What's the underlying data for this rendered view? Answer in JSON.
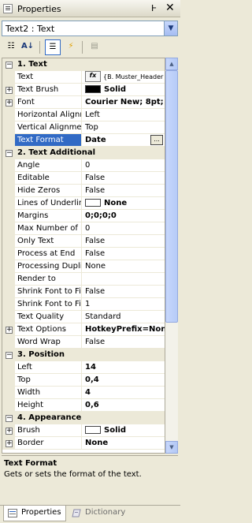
{
  "window": {
    "title": "Properties",
    "pin_glyph": "Ⱶ",
    "close_glyph": "✕"
  },
  "object_selector": {
    "value": "Text2 : Text",
    "drop_glyph": "▼"
  },
  "toolbar": {
    "buttons": [
      {
        "name": "categorized-icon",
        "glyph": "☷"
      },
      {
        "name": "alphabetical-icon",
        "glyph": "A↓"
      },
      {
        "name": "properties-icon",
        "glyph": "☰"
      },
      {
        "name": "events-icon",
        "glyph": "⚡"
      },
      {
        "name": "property-pages-icon",
        "glyph": "▤"
      }
    ]
  },
  "grid": {
    "rows": [
      {
        "type": "cat",
        "label": "1. Text"
      },
      {
        "label": "Text",
        "value": "{B. Muster_Header",
        "kind": "fx",
        "fx_label": "fx"
      },
      {
        "label": "Text Brush",
        "value": "Solid",
        "kind": "swatch-black",
        "expand": true,
        "bold": true
      },
      {
        "label": "Font",
        "value": "Courier New; 8pt;",
        "expand": true,
        "bold": true
      },
      {
        "label": "Horizontal Alignment",
        "value": "Left"
      },
      {
        "label": "Vertical Alignment",
        "value": "Top"
      },
      {
        "label": "Text Format",
        "value": "Date",
        "selected": true,
        "bold": true,
        "ellipsis": "..."
      },
      {
        "type": "cat",
        "label": "2. Text  Additional"
      },
      {
        "label": "Angle",
        "value": "0"
      },
      {
        "label": "Editable",
        "value": "False"
      },
      {
        "label": "Hide Zeros",
        "value": "False"
      },
      {
        "label": "Lines of Underline",
        "value": "None",
        "kind": "swatch-white",
        "bold": true
      },
      {
        "label": "Margins",
        "value": "0;0;0;0",
        "bold": true
      },
      {
        "label": "Max Number of Lines",
        "value": "0"
      },
      {
        "label": "Only Text",
        "value": "False"
      },
      {
        "label": "Process at End",
        "value": "False"
      },
      {
        "label": "Processing Duplicates",
        "value": "None"
      },
      {
        "label": "Render to",
        "value": ""
      },
      {
        "label": "Shrink Font to Fit",
        "value": "False"
      },
      {
        "label": "Shrink Font to Fit Minimum",
        "value": "1"
      },
      {
        "label": "Text Quality",
        "value": "Standard"
      },
      {
        "label": "Text Options",
        "value": "HotkeyPrefix=None",
        "expand": true,
        "bold": true
      },
      {
        "label": "Word Wrap",
        "value": "False"
      },
      {
        "type": "cat",
        "label": "3. Position"
      },
      {
        "label": "Left",
        "value": "14",
        "bold": true
      },
      {
        "label": "Top",
        "value": "0,4",
        "bold": true
      },
      {
        "label": "Width",
        "value": "4",
        "bold": true
      },
      {
        "label": "Height",
        "value": "0,6",
        "bold": true
      },
      {
        "type": "cat",
        "label": "4. Appearance"
      },
      {
        "label": "Brush",
        "value": "Solid",
        "kind": "swatch-white",
        "expand": true,
        "bold": true
      },
      {
        "label": "Border",
        "value": "None",
        "expand": true,
        "bold": true
      }
    ]
  },
  "scrollbar": {
    "up_glyph": "▲",
    "down_glyph": "▼"
  },
  "description": {
    "title": "Text Format",
    "text": "Gets or sets the format of the text."
  },
  "tabs": [
    {
      "label": "Properties",
      "active": true
    },
    {
      "label": "Dictionary",
      "active": false
    }
  ],
  "colors": {
    "selection": "#316ac5",
    "panel": "#ece9d8",
    "border": "#aca899"
  }
}
